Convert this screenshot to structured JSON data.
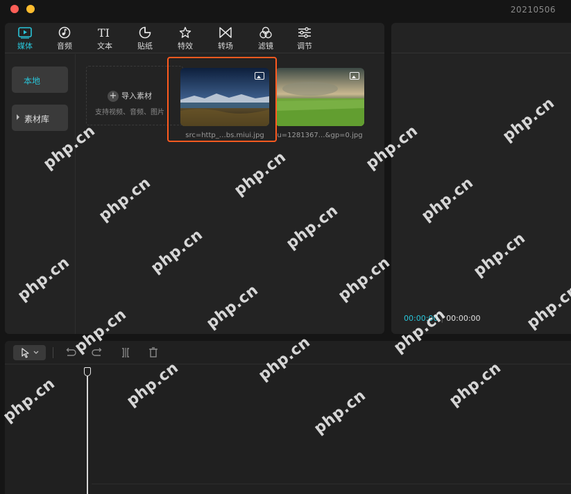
{
  "window": {
    "title": "20210506",
    "traffic_colors": {
      "close": "#ff5f57",
      "minimize": "#febc2e"
    }
  },
  "toolbar": {
    "accent": "#29c5d9",
    "tabs": [
      {
        "label": "媒体",
        "icon": "media-play-icon",
        "active": true
      },
      {
        "label": "音频",
        "icon": "audio-note-icon"
      },
      {
        "label": "文本",
        "icon": "text-ti-icon"
      },
      {
        "label": "贴纸",
        "icon": "sticker-icon"
      },
      {
        "label": "特效",
        "icon": "effects-star-icon"
      },
      {
        "label": "转场",
        "icon": "transition-bowtie-icon"
      },
      {
        "label": "滤镜",
        "icon": "filter-circles-icon"
      },
      {
        "label": "调节",
        "icon": "adjust-sliders-icon"
      }
    ]
  },
  "sidebar": {
    "items": [
      {
        "label": "本地",
        "active": true
      },
      {
        "label": "素材库",
        "expandable": true
      }
    ]
  },
  "import": {
    "label": "导入素材",
    "hint": "支持视频、音频、图片"
  },
  "media_items": [
    {
      "caption": "src=http_…bs.miui.jpg",
      "selected": true,
      "icon": "image-icon"
    },
    {
      "caption": "u=1281367…&gp=0.jpg",
      "selected": false,
      "icon": "image-icon"
    }
  ],
  "selection_color": "#ff5a1f",
  "preview": {
    "current_time": "00:00:00",
    "total_time": "00:00:00"
  },
  "timeline": {
    "tools": [
      "select-pointer-icon",
      "undo-icon",
      "redo-icon",
      "split-icon",
      "delete-icon"
    ]
  },
  "watermark": "php.cn"
}
